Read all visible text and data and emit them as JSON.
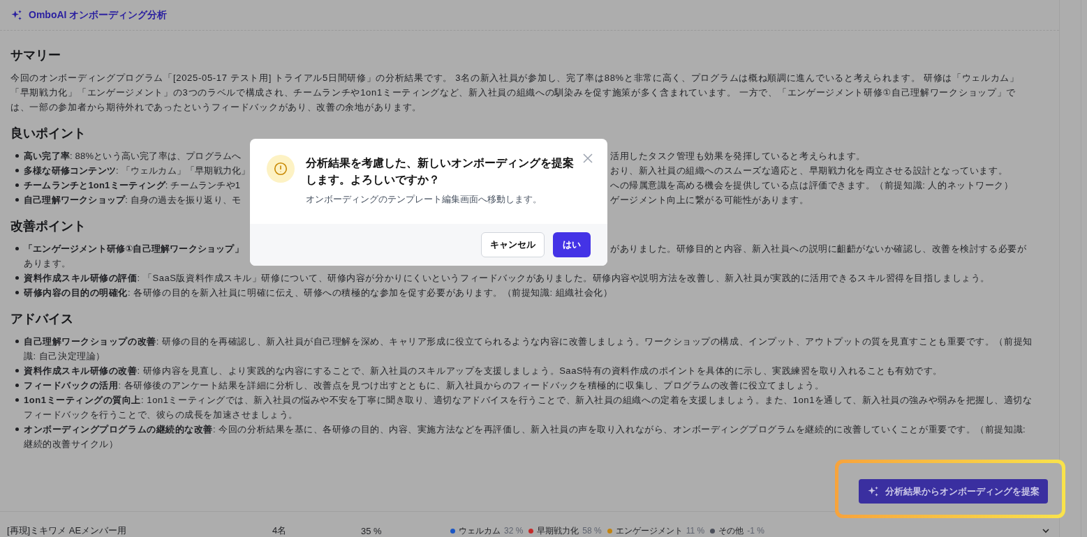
{
  "header": {
    "title": "OmboAI オンボーディング分析"
  },
  "sections": [
    {
      "heading": "サマリー",
      "kind": "paragraph",
      "text": "今回のオンボーディングプログラム「[2025-05-17 テスト用] トライアル5日間研修」の分析結果です。 3名の新入社員が参加し、完了率は88%と非常に高く、プログラムは概ね順調に進んでいると考えられます。 研修は「ウェルカム」「早期戦力化」「エンゲージメント」の3つのラベルで構成され、チームランチや1on1ミーティングなど、新入社員の組織への馴染みを促す施策が多く含まれています。 一方で、「エンゲージメント研修①自己理解ワークショップ」では、一部の参加者から期待外れであったというフィードバックがあり、改善の余地があります。"
    },
    {
      "heading": "良いポイント",
      "kind": "list",
      "items": [
        {
          "kind": "covered",
          "left": "**高い完了率**: 88%という高い完了率は、プログラムへ",
          "right": "活用したタスク管理も効果を発揮していると考えられます。"
        },
        {
          "kind": "covered",
          "left": "**多様な研修コンテンツ**: 「ウェルカム」「早期戦力化」",
          "right": "おり、新入社員の組織へのスムーズな適応と、早期戦力化を両立させる設計となっています。"
        },
        {
          "kind": "covered",
          "left": "**チームランチと1on1ミーティング**: チームランチや1",
          "right": "への帰属意識を高める機会を提供している点は評価できます。（前提知識: 人的ネットワーク）"
        },
        {
          "kind": "covered",
          "left": "**自己理解ワークショップ**: 自身の過去を振り返り、モ",
          "right": "ゲージメント向上に繋がる可能性があります。"
        }
      ]
    },
    {
      "heading": "改善ポイント",
      "kind": "list",
      "items": [
        {
          "kind": "covered",
          "left": "**「エンゲージメント研修①自己理解ワークショップ」**",
          "right": "がありました。研修目的と内容、新入社員への説明に齟齬がないか確認し、改善を検討する必要が",
          "more": "あります。"
        },
        {
          "kind": "full",
          "text": "**資料作成スキル研修の評価**: 「SaaS版資料作成スキル」研修について、研修内容が分かりにくいというフィードバックがありました。研修内容や説明方法を改善し、新入社員が実践的に活用できるスキル習得を目指しましょう。"
        },
        {
          "kind": "full",
          "text": "**研修内容の目的の明確化**: 各研修の目的を新入社員に明確に伝え、研修への積極的な参加を促す必要があります。（前提知識: 組織社会化）"
        }
      ]
    },
    {
      "heading": "アドバイス",
      "kind": "list",
      "items": [
        {
          "kind": "full",
          "text": "**自己理解ワークショップの改善**: 研修の目的を再確認し、新入社員が自己理解を深め、キャリア形成に役立てられるような内容に改善しましょう。ワークショップの構成、インプット、アウトプットの質を見直すことも重要です。（前提知識: 自己決定理論）"
        },
        {
          "kind": "full",
          "text": "**資料作成スキル研修の改善**: 研修内容を見直し、より実践的な内容にすることで、新入社員のスキルアップを支援しましょう。SaaS特有の資料作成のポイントを具体的に示し、実践練習を取り入れることも有効です。"
        },
        {
          "kind": "full",
          "text": "**フィードバックの活用**: 各研修後のアンケート結果を詳細に分析し、改善点を見つけ出すとともに、新入社員からのフィードバックを積極的に収集し、プログラムの改善に役立てましょう。"
        },
        {
          "kind": "full",
          "text": "**1on1ミーティングの質向上**: 1on1ミーティングでは、新入社員の悩みや不安を丁寧に聞き取り、適切なアドバイスを行うことで、新入社員の組織への定着を支援しましょう。また、1on1を通して、新入社員の強みや弱みを把握し、適切なフィードバックを行うことで、彼らの成長を加速させましょう。"
        },
        {
          "kind": "full",
          "text": "**オンボーディングプログラムの継続的な改善**: 今回の分析結果を基に、各研修の目的、内容、実施方法などを再評価し、新入社員の声を取り入れながら、オンボーディングプログラムを継続的に改善していくことが重要です。（前提知識: 継続的改善サイクル）"
        }
      ]
    }
  ],
  "propose_button": {
    "label": "分析結果からオンボーディングを提案",
    "highlighted": true
  },
  "table_row": {
    "name": "[再現]ミキワメ AEメンバー用",
    "count": "4名",
    "rate": "35 %",
    "legend": [
      {
        "label": "ウェルカム",
        "value": "32 %",
        "color": "#1a56c4"
      },
      {
        "label": "早期戦力化",
        "value": "58 %",
        "color": "#c42a2a"
      },
      {
        "label": "エンゲージメント",
        "value": "11 %",
        "color": "#c28410"
      },
      {
        "label": "その他",
        "value": "-1 %",
        "color": "#4b4f5a"
      }
    ]
  },
  "modal": {
    "title": "分析結果を考慮した、新しいオンボーディングを提案します。よろしいですか？",
    "message": "オンボーディングのテンプレート編集画面へ移動します。",
    "cancel": "キャンセル",
    "confirm": "はい"
  }
}
